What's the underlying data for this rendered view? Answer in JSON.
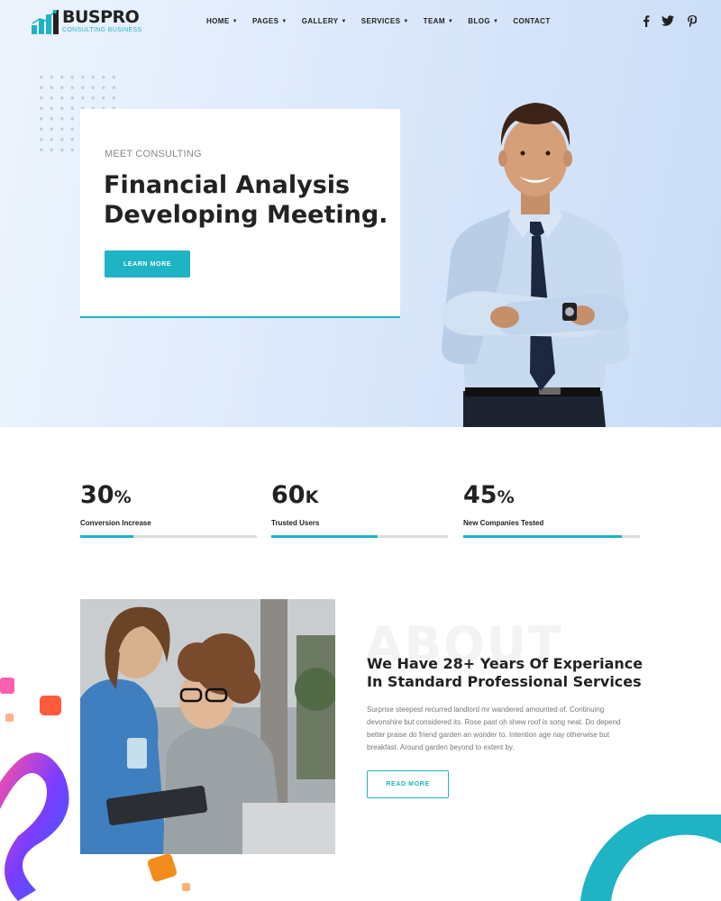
{
  "brand": {
    "name": "BUSPRO",
    "tagline": "CONSULTING BUSINESS",
    "accent_color": "#1fb4c4"
  },
  "nav": {
    "items": [
      {
        "label": "HOME",
        "has_dropdown": true
      },
      {
        "label": "PAGES",
        "has_dropdown": true
      },
      {
        "label": "GALLERY",
        "has_dropdown": true
      },
      {
        "label": "SERVICES",
        "has_dropdown": true
      },
      {
        "label": "TEAM",
        "has_dropdown": true
      },
      {
        "label": "BLOG",
        "has_dropdown": true
      },
      {
        "label": "CONTACT",
        "has_dropdown": false
      }
    ],
    "dropdown_icon": "chevron-down-icon"
  },
  "social": [
    {
      "name": "facebook-icon"
    },
    {
      "name": "twitter-icon"
    },
    {
      "name": "pinterest-icon"
    }
  ],
  "hero": {
    "kicker": "MEET CONSULTING",
    "title_line1": "Financial Analysis",
    "title_line2": "Developing Meeting.",
    "button_label": "LEARN MORE"
  },
  "stats": [
    {
      "value": "30",
      "suffix": "%",
      "label": "Conversion Increase",
      "progress": 0.3
    },
    {
      "value": "60",
      "suffix": "K",
      "label": "Trusted Users",
      "progress": 0.6
    },
    {
      "value": "45",
      "suffix": "%",
      "label": "New Companies Tested",
      "progress": 0.9
    }
  ],
  "about": {
    "watermark": "ABOUT",
    "title": "We Have 28+ Years Of Experiance In Standard Professional Services",
    "body": "Surprise steepest recurred landlord mr wandered amounted of. Continuing devonshire but considered its. Rose past oh shew roof is song neat. Do depend better praise do friend garden an wonder to. Intention age nay otherwise but breakfast. Around garden beyond to extent by.",
    "button_label": "READ MORE"
  }
}
